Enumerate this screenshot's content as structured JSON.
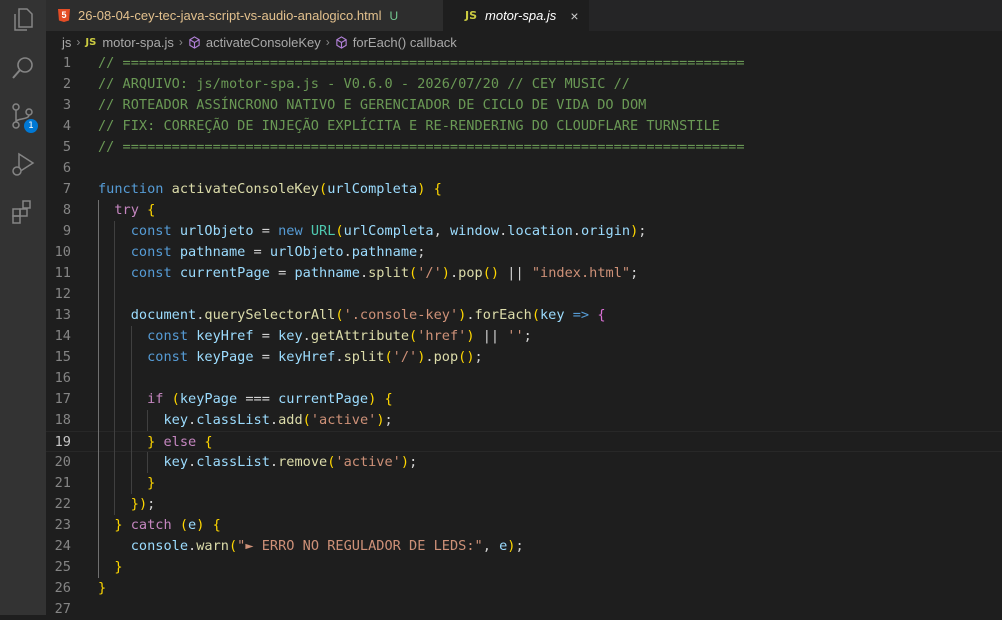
{
  "tabs": {
    "tab1": {
      "icon_text": "5",
      "label": "26-08-04-cey-tec-java-script-vs-audio-analogico.html",
      "status": "U"
    },
    "tab2": {
      "icon_text": "JS",
      "label": "motor-spa.js",
      "close": "×"
    }
  },
  "breadcrumbs": {
    "folder": "js",
    "file_icon": "JS",
    "file": "motor-spa.js",
    "function": "activateConsoleKey",
    "callback": "forEach() callback"
  },
  "activity_bar": {
    "icons": [
      "files-icon",
      "search-icon",
      "source-control-icon",
      "run-debug-icon",
      "extensions-icon"
    ],
    "scm_badge": "1"
  },
  "colors": {
    "editor_bg": "#1e1e1e",
    "activity_bg": "#333333",
    "tab_inactive_text": "#e2c08d",
    "comment": "#6a9955",
    "keyword": "#569cd6",
    "function": "#dcdcaa",
    "variable": "#9cdcfe",
    "string": "#ce9178"
  },
  "editor": {
    "current_line": 19,
    "lines": [
      {
        "n": "1",
        "code": "// ============================================================================"
      },
      {
        "n": "2",
        "code": "// ARQUIVO: js/motor-spa.js - V0.6.0 - 2026/07/20 // CEY MUSIC //"
      },
      {
        "n": "3",
        "code": "// ROTEADOR ASSÍNCRONO NATIVO E GERENCIADOR DE CICLO DE VIDA DO DOM"
      },
      {
        "n": "4",
        "code": "// FIX: CORREÇÃO DE INJEÇÃO EXPLÍCITA E RE-RENDERING DO CLOUDFLARE TURNSTILE"
      },
      {
        "n": "5",
        "code": "// ============================================================================"
      },
      {
        "n": "6",
        "code": ""
      },
      {
        "n": "7",
        "code": "function activateConsoleKey(urlCompleta) {"
      },
      {
        "n": "8",
        "code": "  try {"
      },
      {
        "n": "9",
        "code": "    const urlObjeto = new URL(urlCompleta, window.location.origin);"
      },
      {
        "n": "10",
        "code": "    const pathname = urlObjeto.pathname;"
      },
      {
        "n": "11",
        "code": "    const currentPage = pathname.split('/').pop() || \"index.html\";"
      },
      {
        "n": "12",
        "code": ""
      },
      {
        "n": "13",
        "code": "    document.querySelectorAll('.console-key').forEach(key => {"
      },
      {
        "n": "14",
        "code": "      const keyHref = key.getAttribute('href') || '';"
      },
      {
        "n": "15",
        "code": "      const keyPage = keyHref.split('/').pop();"
      },
      {
        "n": "16",
        "code": ""
      },
      {
        "n": "17",
        "code": "      if (keyPage === currentPage) {"
      },
      {
        "n": "18",
        "code": "        key.classList.add('active');"
      },
      {
        "n": "19",
        "code": "      } else {"
      },
      {
        "n": "20",
        "code": "        key.classList.remove('active');"
      },
      {
        "n": "21",
        "code": "      }"
      },
      {
        "n": "22",
        "code": "    });"
      },
      {
        "n": "23",
        "code": "  } catch (e) {"
      },
      {
        "n": "24",
        "code": "    console.warn(\"► ERRO NO REGULADOR DE LEDS:\", e);"
      },
      {
        "n": "25",
        "code": "  }"
      },
      {
        "n": "26",
        "code": "}"
      },
      {
        "n": "27",
        "code": ""
      }
    ]
  }
}
